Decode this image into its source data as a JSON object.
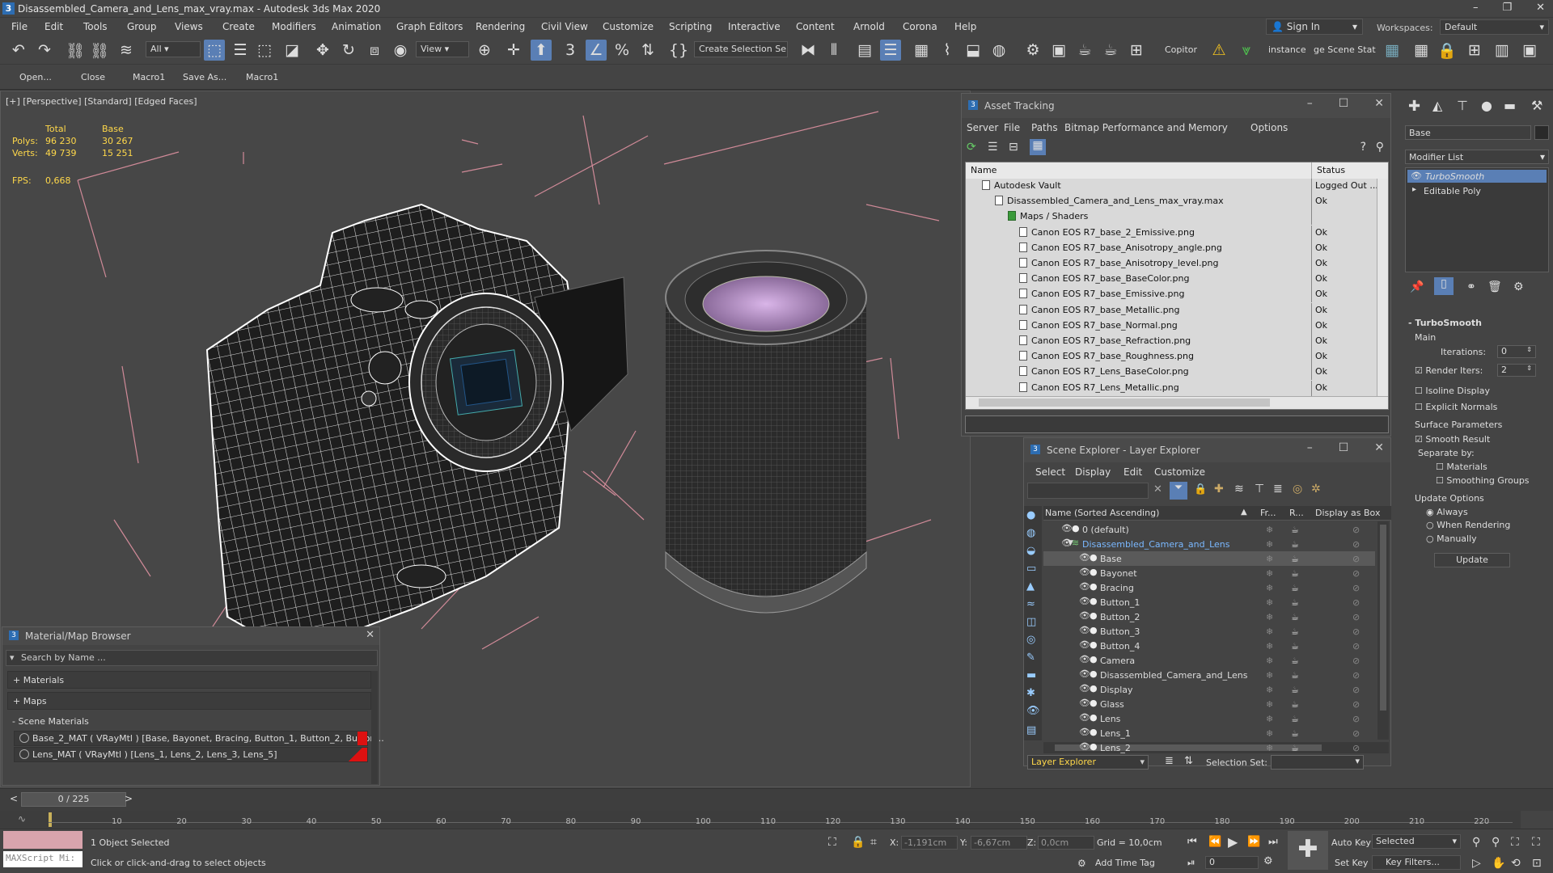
{
  "app": {
    "title": "Disassembled_Camera_and_Lens_max_vray.max - Autodesk 3ds Max 2020",
    "logo": "3"
  },
  "menu": [
    "File",
    "Edit",
    "Tools",
    "Group",
    "Views",
    "Create",
    "Modifiers",
    "Animation",
    "Graph Editors",
    "Rendering",
    "Civil View",
    "Customize",
    "Scripting",
    "Interactive",
    "Content",
    "Arnold",
    "Corona",
    "Help"
  ],
  "signin": {
    "label": "Sign In"
  },
  "workspaces": {
    "label": "Workspaces:",
    "value": "Default"
  },
  "toolbar": {
    "filter": "All",
    "view": "View",
    "selection_set": "Create Selection Se",
    "copitor": "Copitor",
    "instance": "instance",
    "scene_state": "ge Scene Stat"
  },
  "toolbar2": {
    "open": "Open...",
    "close": "Close",
    "macro1": "Macro1",
    "save_as": "Save As...",
    "macro1b": "Macro1"
  },
  "viewport": {
    "label": "[+] [Perspective] [Standard] [Edged Faces]",
    "stats": {
      "total": "Total",
      "base": "Base",
      "polys_label": "Polys:",
      "polys_total": "96 230",
      "polys_base": "30 267",
      "verts_label": "Verts:",
      "verts_total": "49 739",
      "verts_base": "15 251",
      "fps_label": "FPS:",
      "fps_value": "0,668"
    }
  },
  "asset_tracking": {
    "title": "Asset Tracking",
    "menu": [
      "Server",
      "File",
      "Paths",
      "Bitmap Performance and Memory",
      "Options"
    ],
    "col_name": "Name",
    "col_status": "Status",
    "rows": [
      {
        "name": "Autodesk Vault",
        "status": "Logged Out ..."
      },
      {
        "name": "Disassembled_Camera_and_Lens_max_vray.max",
        "status": "Ok"
      },
      {
        "name": "Maps / Shaders",
        "status": ""
      },
      {
        "name": "Canon EOS R7_base_2_Emissive.png",
        "status": "Ok"
      },
      {
        "name": "Canon EOS R7_base_Anisotropy_angle.png",
        "status": "Ok"
      },
      {
        "name": "Canon EOS R7_base_Anisotropy_level.png",
        "status": "Ok"
      },
      {
        "name": "Canon EOS R7_base_BaseColor.png",
        "status": "Ok"
      },
      {
        "name": "Canon EOS R7_base_Emissive.png",
        "status": "Ok"
      },
      {
        "name": "Canon EOS R7_base_Metallic.png",
        "status": "Ok"
      },
      {
        "name": "Canon EOS R7_base_Normal.png",
        "status": "Ok"
      },
      {
        "name": "Canon EOS R7_base_Refraction.png",
        "status": "Ok"
      },
      {
        "name": "Canon EOS R7_base_Roughness.png",
        "status": "Ok"
      },
      {
        "name": "Canon EOS R7_Lens_BaseColor.png",
        "status": "Ok"
      },
      {
        "name": "Canon EOS R7_Lens_Metallic.png",
        "status": "Ok"
      }
    ]
  },
  "scene_explorer": {
    "title": "Scene Explorer - Layer Explorer",
    "menu": [
      "Select",
      "Display",
      "Edit",
      "Customize"
    ],
    "col_name": "Name (Sorted Ascending)",
    "col_fr": "Fr...",
    "col_r": "R...",
    "col_box": "Display as Box",
    "rows": [
      "0 (default)",
      "Disassembled_Camera_and_Lens",
      "Base",
      "Bayonet",
      "Bracing",
      "Button_1",
      "Button_2",
      "Button_3",
      "Button_4",
      "Camera",
      "Disassembled_Camera_and_Lens",
      "Display",
      "Glass",
      "Lens",
      "Lens_1",
      "Lens_2"
    ],
    "footer": {
      "explorer": "Layer Explorer",
      "selection_set": "Selection Set:"
    }
  },
  "material_browser": {
    "title": "Material/Map Browser",
    "search_placeholder": "Search by Name ...",
    "materials": "+ Materials",
    "maps": "+ Maps",
    "scene_materials": "- Scene Materials",
    "items": [
      "Base_2_MAT  ( VRayMtl )  [Base, Bayonet, Bracing, Button_1, Button_2, Button...",
      "Lens_MAT  ( VRayMtl )  [Lens_1, Lens_2, Lens_3, Lens_5]"
    ]
  },
  "command_panel": {
    "object_name": "Base",
    "modifier_list": "Modifier List",
    "stack": [
      "TurboSmooth",
      "Editable Poly"
    ],
    "rollout": "TurboSmooth",
    "main": "Main",
    "iterations_label": "Iterations:",
    "iterations": "0",
    "render_iters_label": "Render Iters:",
    "render_iters": "2",
    "isoline": "Isoline Display",
    "explicit": "Explicit Normals",
    "surface": "Surface Parameters",
    "smooth_result": "Smooth Result",
    "separate_by": "Separate by:",
    "materials": "Materials",
    "smoothing_groups": "Smoothing Groups",
    "update_options": "Update Options",
    "always": "Always",
    "when_rendering": "When Rendering",
    "manually": "Manually",
    "update": "Update"
  },
  "timeline": {
    "frame": "0 / 225",
    "ticks": [
      "10",
      "20",
      "30",
      "40",
      "50",
      "60",
      "70",
      "80",
      "90",
      "100",
      "110",
      "120",
      "130",
      "140",
      "150",
      "160",
      "170",
      "180",
      "190",
      "200",
      "210",
      "220"
    ]
  },
  "status": {
    "selected": "1 Object Selected",
    "prompt": "Click or click-and-drag to select objects",
    "maxscript": "MAXScript Mi:",
    "x_label": "X:",
    "x": "-1,191cm",
    "y_label": "Y:",
    "y": "-6,67cm",
    "z_label": "Z:",
    "z": "0,0cm",
    "grid": "Grid = 10,0cm",
    "add_time_tag": "Add Time Tag",
    "auto_key": "Auto Key",
    "set_key": "Set Key",
    "key_mode": "Selected",
    "key_filters": "Key Filters...",
    "frame_field": "0"
  },
  "colors": {
    "accent": "#5a7fb5",
    "selection": "#2a74c9",
    "bbox": "#d08090",
    "wire": "#ffffff"
  }
}
